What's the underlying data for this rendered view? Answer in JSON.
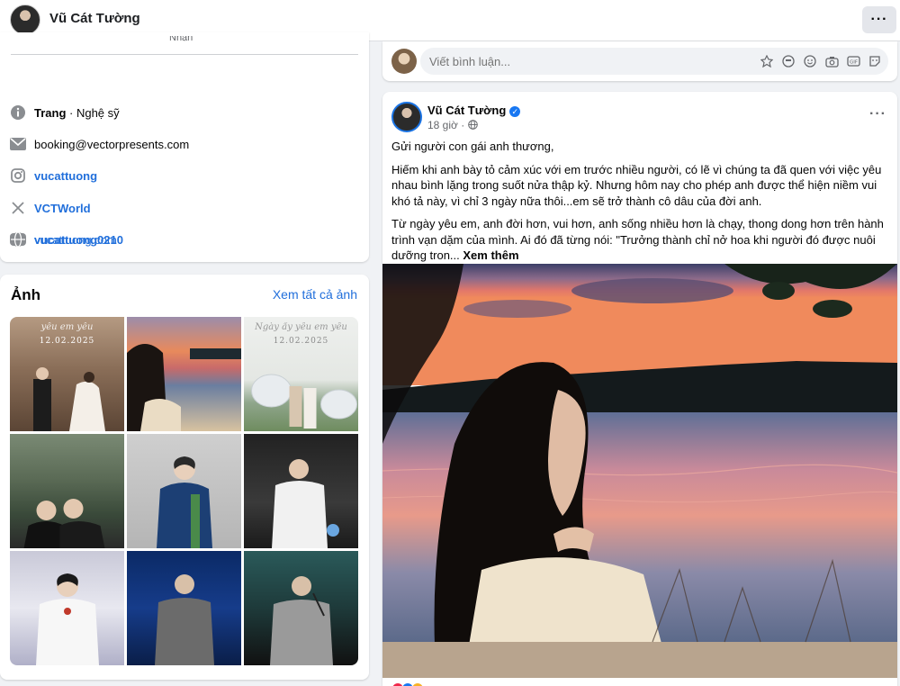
{
  "header": {
    "page_name": "Vũ Cát Tường",
    "more_icon": "more-horizontal-icon"
  },
  "intro": {
    "category_prefix": "Trang",
    "category_rest": " · Nghệ sỹ",
    "email": "booking@vectorpresents.com",
    "instagram": "vucattuong",
    "x_handle": "VCTWorld",
    "youtube": "vucattuong0210",
    "website": "vucattuong.com"
  },
  "photos": {
    "title": "Ảnh",
    "see_all": "Xem tất cả ảnh",
    "tile1_script": "yêu em yêu",
    "tile1_date": "12.02.2025",
    "tile3_script": "Ngày ấy yêu em yêu",
    "tile3_date": "12.02.2025"
  },
  "comment": {
    "placeholder": "Viết bình luận..."
  },
  "post": {
    "author": "Vũ Cát Tường",
    "time": "18 giờ",
    "privacy_icon": "globe-icon",
    "greeting": "Gửi người con gái anh thương,",
    "para1": "Hiếm khi anh bày tỏ cảm xúc với em trước nhiều người, có lẽ vì chúng ta đã quen với việc yêu nhau bình lặng trong suốt nửa thập kỷ. Nhưng hôm nay cho phép anh được thể hiện niềm vui khó tả này, vì chỉ 3 ngày nữa thôi...em sẽ trở thành cô dâu của đời anh.",
    "para2": "Từ ngày yêu em, anh đời hơn, vui hơn, anh sống nhiều hơn là chạy, thong dong hơn trên hành trình vạn dặm của mình. Ai đó đã từng nói: \"Trưởng thành chỉ nở hoa khi người đó được nuôi dưỡng tron...",
    "see_more": "Xem thêm"
  },
  "colors": {
    "link": "#216fdb",
    "verified": "#1877f2",
    "bg": "#f0f2f5"
  }
}
